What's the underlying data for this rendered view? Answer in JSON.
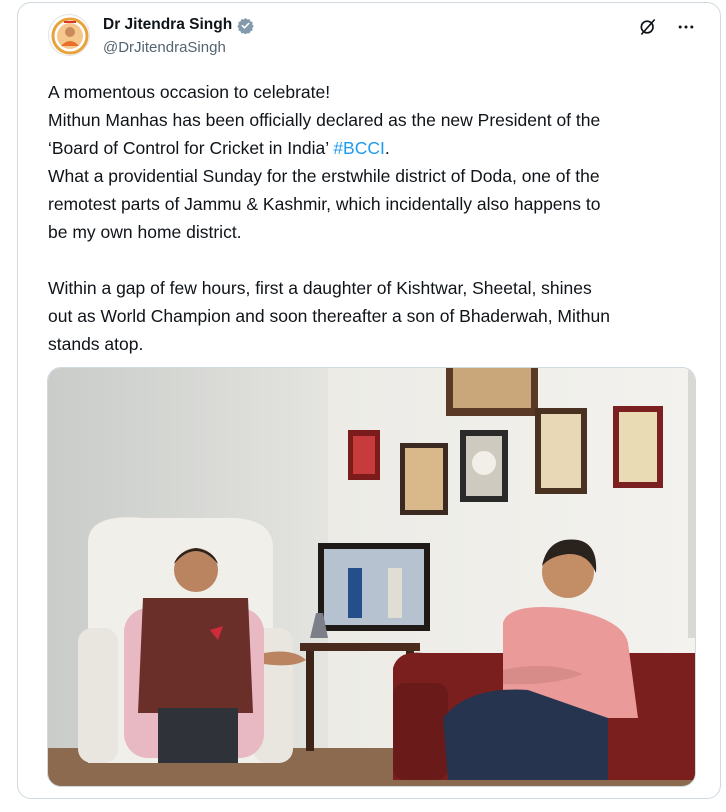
{
  "author": {
    "name": "Dr Jitendra Singh",
    "handle": "@DrJitendraSingh",
    "verified": true,
    "verified_color": "#829aab"
  },
  "header_icons": [
    "grok-icon",
    "more-options-icon"
  ],
  "tweet": {
    "line1": "A momentous occasion to celebrate!",
    "line2_prefix": "Mithun Manhas has been officially declared as the new President of the",
    "line3_prefix": "‘Board of Control for Cricket in India’ ",
    "hashtag": "#BCCI",
    "line3_suffix": ".",
    "line4": "What a providential Sunday for the erstwhile district of Doda, one of the",
    "line5": "remotest parts of Jammu & Kashmir, which incidentally also happens to",
    "line6": "be my own home district.",
    "line7": "Within a gap of few hours, first a daughter of Kishtwar, Sheetal, shines",
    "line8": "out as World Champion and soon thereafter a son of Bhaderwah, Mithun",
    "line9": "stands atop."
  },
  "colors": {
    "text": "#0f1419",
    "secondary": "#536471",
    "link": "#1d9bf0",
    "border": "#cfd9de"
  }
}
